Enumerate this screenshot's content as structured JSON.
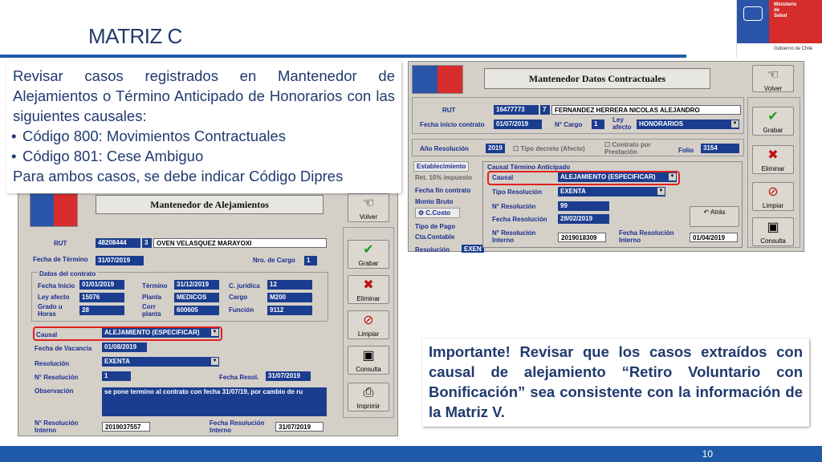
{
  "slide": {
    "title": "MATRIZ C",
    "page_number": "10"
  },
  "logo": {
    "line1": "Ministerio",
    "line2": "de",
    "line3": "Salud",
    "footer": "Gobierno de Chile"
  },
  "textbox": {
    "intro": "Revisar casos registrados en Mantenedor de Alejamientos o Término Anticipado de Honorarios con las siguientes causales:",
    "bullets": [
      "Código 800: Movimientos Contractuales",
      "Código 801: Cese Ambiguo"
    ],
    "outro": "Para ambos casos, se debe indicar Código Dipres"
  },
  "important": {
    "text": "Importante! Revisar que los casos extraídos con causal de alejamiento “Retiro Voluntario con Bonificación” sea consistente con la información de la Matriz V."
  },
  "screen1": {
    "header": "Mantenedor de Alejamientos",
    "rut_label": "RUT",
    "rut_value": "48208444",
    "rut_dv": "3",
    "name": "OVEN VELASQUEZ MARAYOXI",
    "fecha_termino_label": "Fecha de Término",
    "fecha_termino": "31/07/2019",
    "nro_cargo_label": "Nro. de Cargo",
    "nro_cargo": "1",
    "datos_label": "Datos del contrato",
    "fecha_inicio_label": "Fecha Inicio",
    "fecha_inicio": "01/01/2019",
    "termino_label": "Término",
    "termino": "31/12/2019",
    "cjuridica_label": "C. jurídica",
    "cjuridica": "12",
    "ley_label": "Ley afecto",
    "ley": "15076",
    "planta_label": "Planta",
    "planta": "MEDICOS",
    "cargo_label": "Cargo",
    "cargo": "M200",
    "grado_label": "Grado u Horas",
    "grado": "28",
    "corr_label": "Corr planta",
    "corr": "600605",
    "funcion_label": "Función",
    "funcion": "9112",
    "causal_label": "Causal",
    "causal": "ALEJAMIENTO (ESPECIFICAR)",
    "vacancia_label": "Fecha de Vacancia",
    "vacancia": "01/08/2019",
    "resolucion_label": "Resolución",
    "resolucion": "EXENTA",
    "nres_label": "N° Resolución",
    "nres": "1",
    "fres_label": "Fecha Resol.",
    "fres": "31/07/2019",
    "obs_label": "Observación",
    "obs": "se pone termino al contrato con fecha 31/07/19, por cambio de ru",
    "nres_int_label": "N° Resolución Interno",
    "nres_int": "2019037557",
    "fres_int_label": "Fecha Resolución Interno",
    "fres_int": "31/07/2019",
    "buttons": [
      "Volver",
      "Grabar",
      "Eliminar",
      "Limpiar",
      "Consulta",
      "Imprimir"
    ]
  },
  "screen2": {
    "header": "Mantenedor Datos Contractuales",
    "rut_label": "RUT",
    "rut_value": "16477773",
    "rut_dv": "7",
    "name": "FERNANDEZ HERRERA NICOLAS ALEJANDRO",
    "fecha_inicio_label": "Fecha inicio contrato",
    "fecha_inicio": "01/07/2019",
    "ncargo_label": "N° Cargo",
    "ncargo": "1",
    "ley_label": "Ley afecto",
    "ley": "HONORARIOS",
    "anio_label": "Año Resolución",
    "anio": "2019",
    "tipo_decreto_label": "Tipo decreto (Afecto)",
    "contrato_label": "Contrato por Prestación",
    "folio_label": "Folio",
    "folio": "3154",
    "tab_label": "Establecimiento",
    "retencion_label": "Ret. 10% impuesto",
    "fecha_fin_label": "Fecha fin contrato",
    "monto_label": "Monto Bruto",
    "ccosto_label": "C.Costo",
    "tipo_pago_label": "Tipo de Pago",
    "cta_label": "Cta.Contable",
    "resol_label": "Resolución",
    "resol_value": "EXEN",
    "group_label": "Causal Término Anticipado",
    "causal_label": "Causal",
    "causal": "ALEJAMIENTO (ESPECIFICAR)",
    "tipo_res_label": "Tipo Resolución",
    "tipo_res": "EXENTA",
    "nres_label": "N° Resolución",
    "nres": "99",
    "fres_label": "Fecha Resolución",
    "fres": "28/02/2019",
    "nres_int_label": "N° Resolución Interno",
    "nres_int": "2019018309",
    "fres_int_label": "Fecha Resolución Interno",
    "fres_int": "01/04/2019",
    "atras_label": "Atrás",
    "buttons": [
      "Volver",
      "Grabar",
      "Eliminar",
      "Limpiar",
      "Consulta"
    ]
  }
}
